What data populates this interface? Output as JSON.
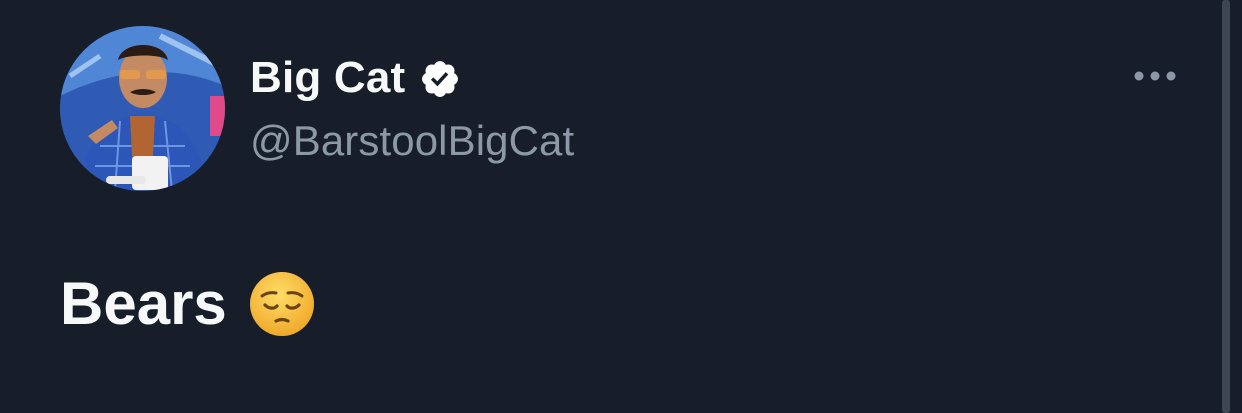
{
  "tweet": {
    "author": {
      "display_name": "Big Cat",
      "handle": "@BarstoolBigCat",
      "verified": true,
      "avatar": "profile-photo"
    },
    "text": "Bears",
    "emoji": "pensive-face",
    "more_icon": "more-horizontal-icon"
  },
  "colors": {
    "background": "#171e29",
    "name_text": "#f7f9f9",
    "handle_text": "#8b98a5",
    "verified_badge": "#ffffff",
    "emoji_yellow": "#fbc43f"
  }
}
